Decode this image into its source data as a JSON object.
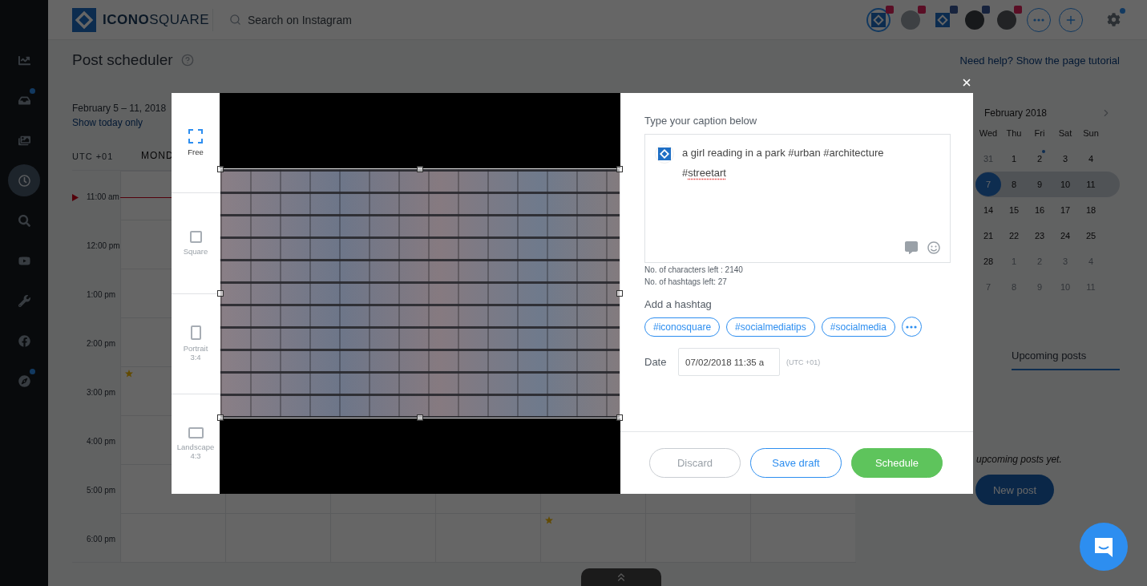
{
  "sidebar": {
    "items": [
      {
        "selected": false,
        "badge": false
      },
      {
        "selected": false,
        "badge": true
      },
      {
        "selected": false,
        "badge": false
      },
      {
        "selected": true,
        "badge": false
      },
      {
        "selected": false,
        "badge": false
      },
      {
        "selected": false,
        "badge": false
      },
      {
        "selected": false,
        "badge": false
      },
      {
        "selected": false,
        "badge": false
      },
      {
        "selected": false,
        "badge": true
      }
    ]
  },
  "header": {
    "logo": "**ICONO**SQUARE",
    "search": {
      "placeholder": "Search on Instagram"
    },
    "accounts": [
      {
        "selected": true,
        "kind": "instagram"
      },
      {
        "selected": false,
        "kind": "instagram"
      },
      {
        "selected": false,
        "kind": "facebook"
      },
      {
        "selected": false,
        "kind": "facebook"
      },
      {
        "selected": false,
        "kind": "instagram"
      }
    ],
    "settings_badge": true
  },
  "page": {
    "title": "Post scheduler",
    "help_link": "Need help? Show the page tutorial"
  },
  "calendar": {
    "date_range": "February 5 – 11, 2018",
    "today_link": "Show today only",
    "timezone": "UTC +01",
    "day_header": "MOND",
    "rows": [
      {
        "time": "11:00 am",
        "now": true,
        "starred": [
          false,
          false,
          false,
          false,
          false,
          false,
          false
        ]
      },
      {
        "time": "12:00 pm",
        "now": false,
        "starred": [
          false,
          false,
          false,
          false,
          false,
          false,
          false
        ]
      },
      {
        "time": "1:00 pm",
        "now": false,
        "starred": [
          false,
          false,
          false,
          false,
          false,
          false,
          false
        ]
      },
      {
        "time": "2:00 pm",
        "now": false,
        "starred": [
          false,
          false,
          false,
          false,
          false,
          false,
          false
        ]
      },
      {
        "time": "3:00 pm",
        "now": false,
        "starred": [
          true,
          false,
          false,
          false,
          false,
          false,
          false
        ]
      },
      {
        "time": "4:00 pm",
        "now": false,
        "starred": [
          false,
          false,
          false,
          false,
          false,
          false,
          false
        ]
      },
      {
        "time": "5:00 pm",
        "now": false,
        "starred": [
          false,
          false,
          false,
          false,
          false,
          false,
          false
        ]
      },
      {
        "time": "6:00 pm",
        "now": false,
        "starred": [
          false,
          false,
          false,
          false,
          true,
          false,
          false
        ]
      }
    ]
  },
  "mini_calendar": {
    "month": "February 2018",
    "weekdays": [
      "Wed",
      "Thu",
      "Fri",
      "Sat",
      "Sun"
    ],
    "weeks": [
      {
        "current": false,
        "days": [
          {
            "label": "31",
            "muted": true,
            "selected": false,
            "dot": false
          },
          {
            "label": "1",
            "muted": false,
            "selected": false,
            "dot": false
          },
          {
            "label": "2",
            "muted": false,
            "selected": false,
            "dot": true
          },
          {
            "label": "3",
            "muted": false,
            "selected": false,
            "dot": false
          },
          {
            "label": "4",
            "muted": false,
            "selected": false,
            "dot": false
          }
        ]
      },
      {
        "current": true,
        "days": [
          {
            "label": "7",
            "muted": false,
            "selected": true,
            "dot": false
          },
          {
            "label": "8",
            "muted": false,
            "selected": false,
            "dot": false
          },
          {
            "label": "9",
            "muted": false,
            "selected": false,
            "dot": false
          },
          {
            "label": "10",
            "muted": false,
            "selected": false,
            "dot": false
          },
          {
            "label": "11",
            "muted": false,
            "selected": false,
            "dot": false
          }
        ]
      },
      {
        "current": false,
        "days": [
          {
            "label": "14",
            "muted": false,
            "selected": false,
            "dot": false
          },
          {
            "label": "15",
            "muted": false,
            "selected": false,
            "dot": false
          },
          {
            "label": "16",
            "muted": false,
            "selected": false,
            "dot": false
          },
          {
            "label": "17",
            "muted": false,
            "selected": false,
            "dot": false
          },
          {
            "label": "18",
            "muted": false,
            "selected": false,
            "dot": false
          }
        ]
      },
      {
        "current": false,
        "days": [
          {
            "label": "21",
            "muted": false,
            "selected": false,
            "dot": false
          },
          {
            "label": "22",
            "muted": false,
            "selected": false,
            "dot": false
          },
          {
            "label": "23",
            "muted": false,
            "selected": false,
            "dot": false
          },
          {
            "label": "24",
            "muted": false,
            "selected": false,
            "dot": false
          },
          {
            "label": "25",
            "muted": false,
            "selected": false,
            "dot": false
          }
        ]
      },
      {
        "current": false,
        "days": [
          {
            "label": "28",
            "muted": false,
            "selected": false,
            "dot": false
          },
          {
            "label": "1",
            "muted": true,
            "selected": false,
            "dot": false
          },
          {
            "label": "2",
            "muted": true,
            "selected": false,
            "dot": false
          },
          {
            "label": "3",
            "muted": true,
            "selected": false,
            "dot": false
          },
          {
            "label": "4",
            "muted": true,
            "selected": false,
            "dot": false
          }
        ]
      },
      {
        "current": false,
        "days": [
          {
            "label": "7",
            "muted": true,
            "selected": false,
            "dot": false
          },
          {
            "label": "8",
            "muted": true,
            "selected": false,
            "dot": false
          },
          {
            "label": "9",
            "muted": true,
            "selected": false,
            "dot": false
          },
          {
            "label": "10",
            "muted": true,
            "selected": false,
            "dot": false
          },
          {
            "label": "11",
            "muted": true,
            "selected": false,
            "dot": false
          }
        ]
      }
    ]
  },
  "upcoming": {
    "tab": {
      "label": "Upcoming posts",
      "selected": true
    },
    "empty_text": "upcoming posts yet.",
    "new_post": "New post"
  },
  "modal": {
    "crop_options": [
      {
        "kind": "free",
        "label": "Free",
        "selected": true
      },
      {
        "kind": "square",
        "label": "Square",
        "selected": false
      },
      {
        "kind": "portrait",
        "label": "Portrait",
        "ratio": "3:4",
        "selected": false
      },
      {
        "kind": "landscape",
        "label": "Landscape",
        "ratio": "4:3",
        "selected": false
      }
    ],
    "caption_label": "Type your caption below",
    "caption": [
      {
        "text": "a girl reading in a park #urban #architecture #",
        "misspelled": false
      },
      {
        "text": "streetart",
        "misspelled": true
      }
    ],
    "characters_left": "No. of characters left : 2140",
    "hashtags_left": "No. of hashtags left: 27",
    "hashtag_label": "Add a hashtag",
    "hashtags": [
      "#iconosquare",
      "#socialmediatips",
      "#socialmedia"
    ],
    "date_label": "Date",
    "date_value": "07/02/2018 11:35 a",
    "timezone": "(UTC +01)",
    "buttons": [
      {
        "label": "Discard",
        "kind": "muted"
      },
      {
        "label": "Save draft",
        "kind": "outline"
      },
      {
        "label": "Schedule",
        "kind": "primary"
      }
    ]
  }
}
